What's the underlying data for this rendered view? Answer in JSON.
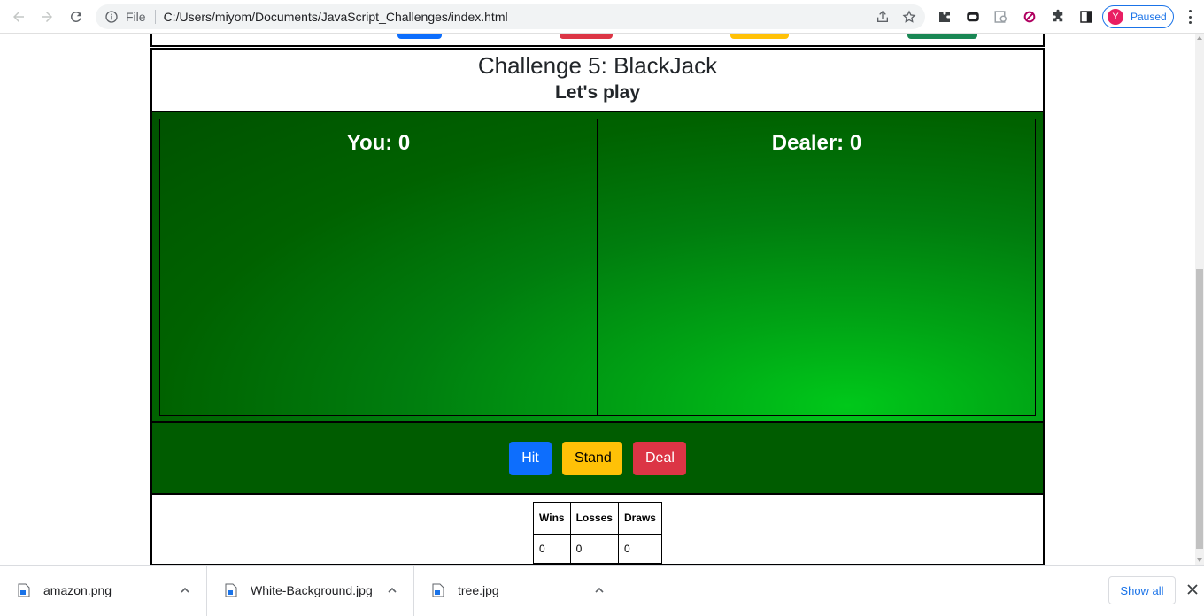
{
  "browser": {
    "file_label": "File",
    "url": "C:/Users/miyom/Documents/JavaScript_Challenges/index.html",
    "profile_initial": "Y",
    "profile_status": "Paused"
  },
  "challenge": {
    "title": "Challenge 5: BlackJack",
    "subtitle": "Let's play",
    "you_label": "You: 0",
    "dealer_label": "Dealer: 0",
    "buttons": {
      "hit": "Hit",
      "stand": "Stand",
      "deal": "Deal"
    },
    "score": {
      "headers": [
        "Wins",
        "Losses",
        "Draws"
      ],
      "values": [
        "0",
        "0",
        "0"
      ]
    }
  },
  "previous_section_buttons": [
    {
      "color": "#0d6efd"
    },
    {
      "color": "#dc3545"
    },
    {
      "color": "#ffc107"
    },
    {
      "color": "#198754"
    }
  ],
  "downloads": {
    "items": [
      {
        "name": "amazon.png"
      },
      {
        "name": "White-Background.jpg"
      },
      {
        "name": "tree.jpg"
      }
    ],
    "show_all": "Show all"
  }
}
